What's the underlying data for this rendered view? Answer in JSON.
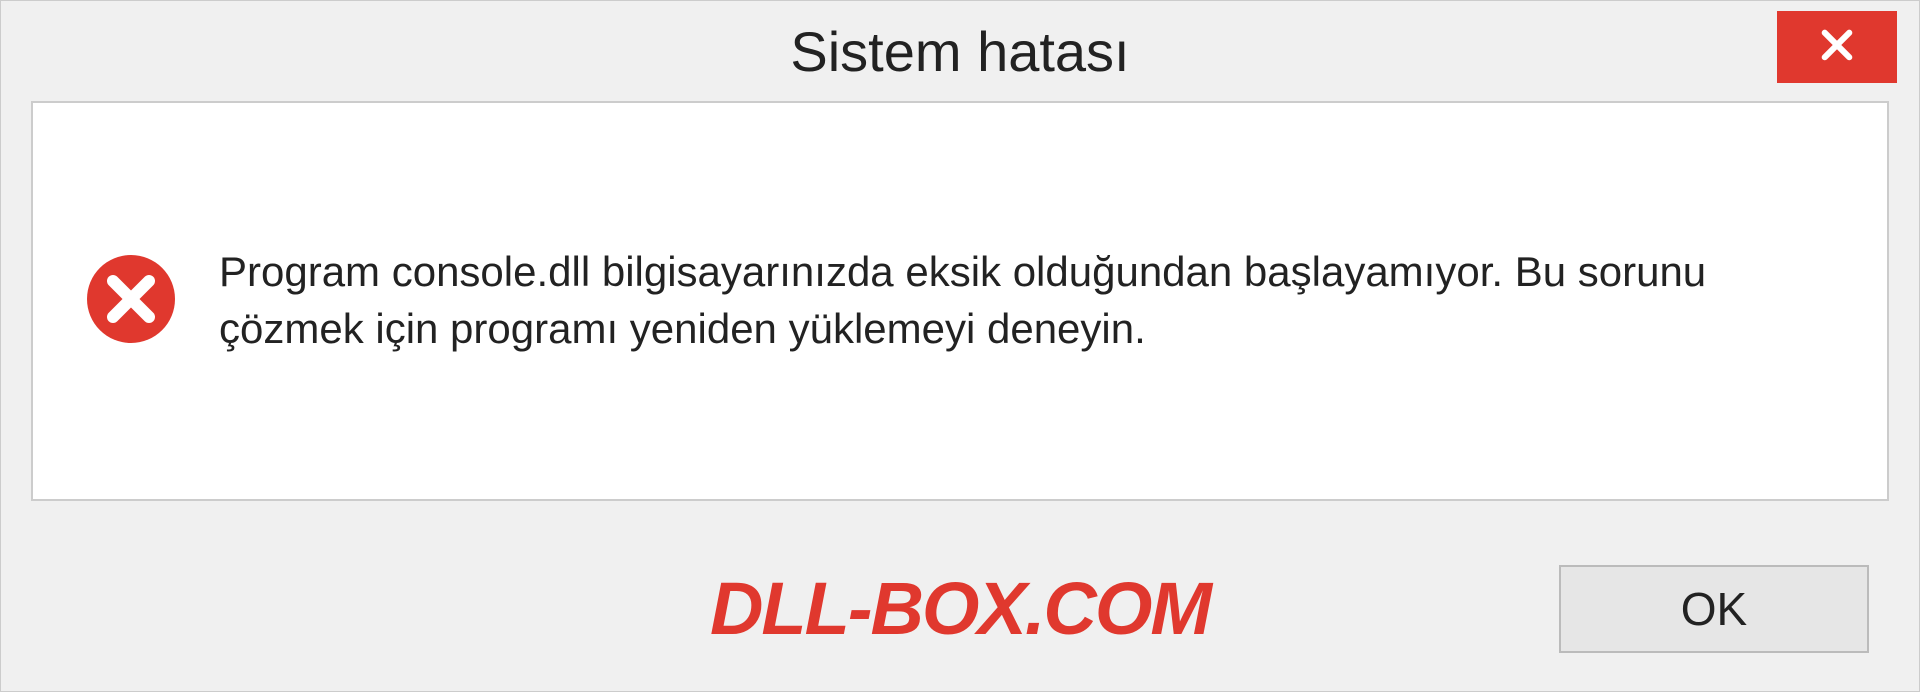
{
  "dialog": {
    "title": "Sistem hatası",
    "message": "Program console.dll bilgisayarınızda eksik olduğundan başlayamıyor. Bu sorunu çözmek için programı yeniden yüklemeyi deneyin.",
    "ok_label": "OK"
  },
  "watermark": "DLL-BOX.COM",
  "colors": {
    "error_red": "#e0382e",
    "dialog_bg": "#f0f0f0",
    "content_bg": "#ffffff"
  }
}
